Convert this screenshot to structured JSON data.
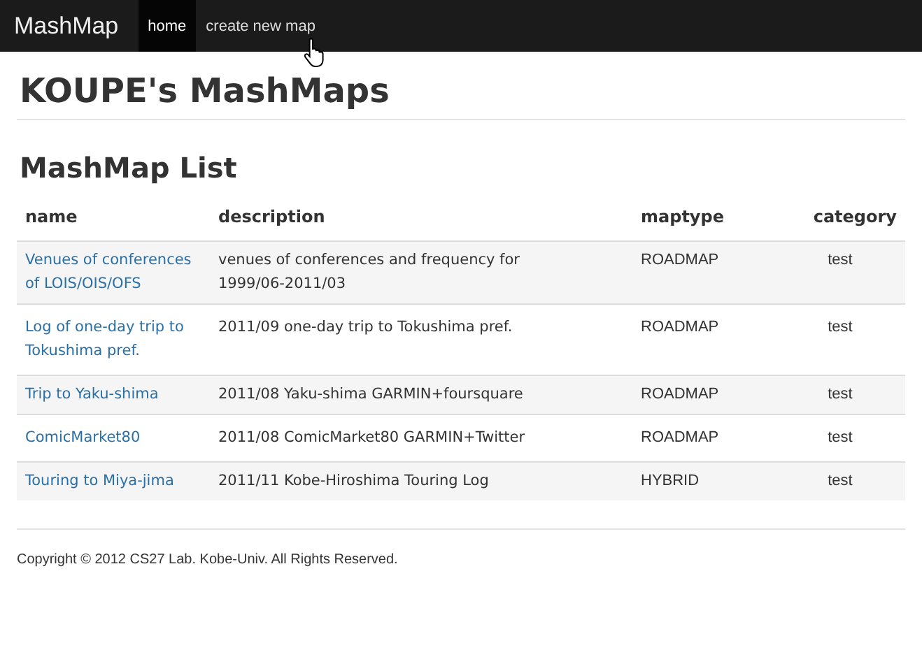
{
  "navbar": {
    "brand": "MashMap",
    "items": [
      {
        "label": "home",
        "selected": true
      },
      {
        "label": "create new map",
        "selected": false
      }
    ]
  },
  "page_title": "KOUPE's MashMaps",
  "section_title": "MashMap List",
  "table": {
    "columns": [
      "name",
      "description",
      "maptype",
      "category"
    ],
    "rows": [
      {
        "name": "Venues of conferences of LOIS/OIS/OFS",
        "description": "venues of conferences and frequency for 1999/06-2011/03",
        "maptype": "ROADMAP",
        "category": "test"
      },
      {
        "name": "Log of one-day trip to Tokushima pref.",
        "description": "2011/09 one-day trip to Tokushima pref.",
        "maptype": "ROADMAP",
        "category": "test"
      },
      {
        "name": "Trip to Yaku-shima",
        "description": "2011/08 Yaku-shima GARMIN+foursquare",
        "maptype": "ROADMAP",
        "category": "test"
      },
      {
        "name": "ComicMarket80",
        "description": "2011/08 ComicMarket80 GARMIN+Twitter",
        "maptype": "ROADMAP",
        "category": "test"
      },
      {
        "name": "Touring to Miya-jima",
        "description": "2011/11 Kobe-Hiroshima Touring Log",
        "maptype": "HYBRID",
        "category": "test"
      }
    ]
  },
  "footer": "Copyright © 2012 CS27 Lab. Kobe-Univ. All Rights Reserved."
}
